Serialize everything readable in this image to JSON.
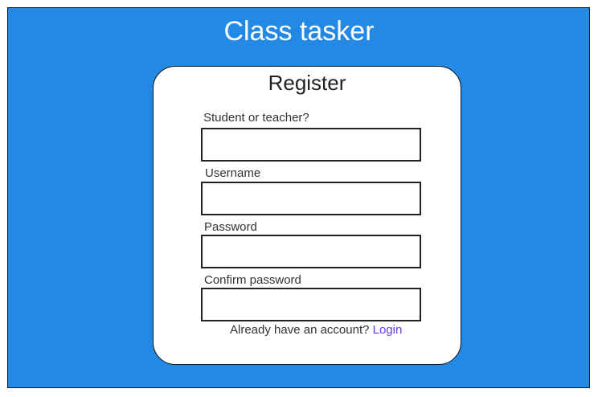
{
  "app": {
    "title": "Class tasker"
  },
  "form": {
    "title": "Register",
    "fields": [
      {
        "label": "Student or teacher?",
        "value": "",
        "placeholder": ""
      },
      {
        "label": "Username",
        "value": "",
        "placeholder": ""
      },
      {
        "label": "Password",
        "value": "",
        "placeholder": ""
      },
      {
        "label": "Confirm password",
        "value": "",
        "placeholder": ""
      }
    ],
    "footer": {
      "prompt": "Already have an account?",
      "link_label": "Login"
    }
  },
  "colors": {
    "background": "#2389e4",
    "card": "#ffffff",
    "link": "#6a3fd6"
  }
}
